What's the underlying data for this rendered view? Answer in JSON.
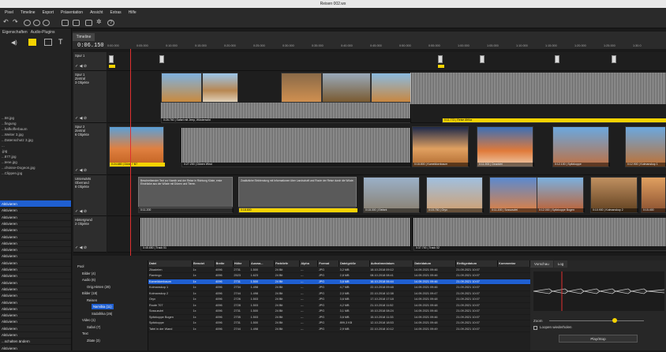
{
  "window": {
    "title": "Reisen 002.wx"
  },
  "menu": [
    "Pixel",
    "Timeline",
    "Export",
    "Präsentation",
    "Ansicht",
    "Extras",
    "Hilfe"
  ],
  "left": {
    "tabs": [
      "Eigenschaften",
      "Audio-Plugins"
    ],
    "files": [
      "...58.jpg",
      "...fingung",
      "...hafkofferbaum",
      "...Weiter 3.jpg",
      "...Datenschutz 3.jpg",
      "...",
      ".jpg",
      "...877.jpg",
      "...tene.jpg",
      "...chüsse-Dogeon.jpg",
      "...Clippen.jpg"
    ],
    "rows": [
      "Aktivieren",
      "Aktivieren",
      "Aktivieren",
      "Aktivieren",
      "Aktivieren",
      "Aktivieren",
      "Aktivieren",
      "Aktivieren",
      "Aktivieren",
      "Aktivieren",
      "Aktivieren",
      "Aktivieren",
      "Aktivieren",
      "Aktivieren",
      "Aktivieren",
      "Aktivieren",
      "Aktivieren",
      "Aktivieren",
      "Aktivieren",
      "Aktivieren",
      "Aktivieren",
      "...schalten ändern",
      "Aktivieren"
    ]
  },
  "timeline": {
    "tab": "Timeline",
    "timecode": "0:06.150",
    "ticks": [
      "0:00.000",
      "0:05.000",
      "0:10.000",
      "0:15.000",
      "0:20.000",
      "0:25.000",
      "0:30.000",
      "0:35.000",
      "0:40.000",
      "0:45.000",
      "0:50.000",
      "0:55.000",
      "1:00.000",
      "1:05.000",
      "1:10.000",
      "1:15.000",
      "1:20.000",
      "1:25.000",
      "1:30.0"
    ],
    "tracks": [
      {
        "name": "Spur 1",
        "sub": "",
        "objects": ""
      },
      {
        "name": "Spur 1",
        "sub": "Zentral",
        "objects": "3 Objekte"
      },
      {
        "name": "Spur 2",
        "sub": "Zentral",
        "objects": "6 Objekte"
      },
      {
        "name": "Unterwärts",
        "sub": "Oberrand",
        "objects": "8 Objekte"
      },
      {
        "name": "Hintergrund",
        "sub": "",
        "objects": "2 Objekte"
      }
    ],
    "clips": {
      "t2a": "0:26.760 | Safari mit Jeep, Wüstenwild",
      "t2b": "0:34.460 | Safari mit Jeep, Wüste",
      "t2c": "0:11.772 | Reise Afrika",
      "t3a": "0:24.680 | Düne 7 B7",
      "t3b": "0:27.200 | Dünen Wind",
      "t3c": "0:18.800 | Kameldornbaum",
      "t3d": "0:11.900 | Deadvlei",
      "t3e": "0:12.100 | Spitzkoppe",
      "t3f": "0:12.900 | Kolmanskop 1",
      "t4text1": "Beschreibender Text zur Namib und der Reise in Richtung Küste, erste Eindrücke aus der Wüste mit Dünen und Tieren.",
      "t4text2": "Zusätzliche Einblendung mit Informationen über Landschaft und Route der Reise durch die Wüste.",
      "t4a": "0:11.200",
      "t4b": "0:18.800",
      "t4c": "0:18.300 | Elefant",
      "t4d": "0:15.750 | Oryx",
      "t4e": "0:11.200 | Sossusvlei",
      "t4f": "0:12.000 | Spitzkoppe Bogen",
      "t4g": "0:10.900 | Kolmanskop 2",
      "t4h": "0:15.400",
      "t5a": "0:45.650 | Track 01",
      "t5b": "0:37.700 | Track 02"
    }
  },
  "tree": [
    {
      "label": "Pool",
      "indent": 0
    },
    {
      "label": "Bilder (4)",
      "indent": 1
    },
    {
      "label": "Audio (6)",
      "indent": 1
    },
    {
      "label": "Orig.Hinten (28)",
      "indent": 2
    },
    {
      "label": "Bilder (18)",
      "indent": 1
    },
    {
      "label": "Reisen",
      "indent": 2
    },
    {
      "label": "Namibia (11)",
      "indent": 3
    },
    {
      "label": "Südafrika (26)",
      "indent": 3
    },
    {
      "label": "Video (1)",
      "indent": 1
    },
    {
      "label": "Safari (7)",
      "indent": 2
    },
    {
      "label": "Text",
      "indent": 1
    },
    {
      "label": "Zitate (3)",
      "indent": 2
    }
  ],
  "table": {
    "headers": [
      "Datei",
      "Benutzt",
      "Breite",
      "Höhe",
      "Auswa...",
      "Farbtiefe",
      "Alpha",
      "Format",
      "Dateigröße",
      "Aufnahmedatum",
      "Dateidatum",
      "Einfügedatum",
      "Kommentar"
    ],
    "rows": [
      [
        "Zikadelen",
        "1x",
        "4096",
        "2731",
        "1.500",
        "24 Bit",
        "---",
        "JPG",
        "3,2 MB",
        "18.10.2018 09:12",
        "14.09.2021 09:46",
        "21.09.2021 10:07",
        ""
      ],
      [
        "Flamingo",
        "1x",
        "4096",
        "2523",
        "1.623",
        "24 Bit",
        "---",
        "JPG",
        "2,8 MB",
        "08.10.2018 08:41",
        "14.09.2021 09:46",
        "21.09.2021 10:07",
        ""
      ],
      [
        "Kameldornbaum",
        "1x",
        "4096",
        "2731",
        "1.500",
        "24 Bit",
        "---",
        "JPG",
        "3,6 MB",
        "16.10.2018 06:44",
        "14.09.2021 09:46",
        "21.09.2021 10:07",
        ""
      ],
      [
        "Kolmanskop 1",
        "1x",
        "4096",
        "2734",
        "1.498",
        "24 Bit",
        "---",
        "JPG",
        "4,7 MB",
        "22.10.2018 09:48",
        "14.09.2021 09:46",
        "21.09.2021 10:07",
        ""
      ],
      [
        "Kolmanskop 2",
        "1x",
        "4096",
        "2744",
        "1.498",
        "24 Bit",
        "---",
        "JPG",
        "2,0 MB",
        "22.10.2018 12:38",
        "14.09.2021 09:47",
        "21.09.2021 10:07",
        ""
      ],
      [
        "Oryx",
        "1x",
        "4096",
        "2726",
        "1.503",
        "24 Bit",
        "---",
        "JPG",
        "3,6 MB",
        "17.10.2018 17:18",
        "14.09.2021 09:48",
        "21.09.2021 10:07",
        ""
      ],
      [
        "Route 707",
        "1x",
        "4096",
        "2728",
        "1.503",
        "24 Bit",
        "---",
        "JPG",
        "4,2 MB",
        "21.10.2018 11:52",
        "14.09.2021 09:48",
        "21.09.2021 10:07",
        ""
      ],
      [
        "Sossusvlei",
        "1x",
        "4096",
        "2731",
        "1.500",
        "24 Bit",
        "---",
        "JPG",
        "3,1 MB",
        "19.10.2018 08:24",
        "14.09.2021 09:46",
        "21.09.2021 10:07",
        ""
      ],
      [
        "Spitzkoppe Bogen",
        "1x",
        "4096",
        "2735",
        "1.503",
        "24 Bit",
        "---",
        "JPG",
        "3,6 MB",
        "15.10.2018 11:33",
        "14.09.2021 09:46",
        "21.09.2021 10:07",
        ""
      ],
      [
        "Spitzkoppe",
        "1x",
        "4096",
        "2731",
        "1.500",
        "24 Bit",
        "---",
        "JPG",
        "899,3 KB",
        "12.10.2018 18:53",
        "14.09.2021 09:48",
        "21.09.2021 10:07",
        ""
      ],
      [
        "Tafel in der Wand",
        "1x",
        "4096",
        "2744",
        "1.498",
        "24 Bit",
        "---",
        "JPG",
        "2,9 MB",
        "22.10.2018 10:12",
        "14.09.2021 09:49",
        "21.09.2021 10:07",
        ""
      ]
    ]
  },
  "rightpane": {
    "tabs": [
      "Vorschau",
      "Log"
    ],
    "zoom_label": "Zoom",
    "loop_label": "Loopen wiederholen",
    "play_label": "Play/Stop"
  }
}
